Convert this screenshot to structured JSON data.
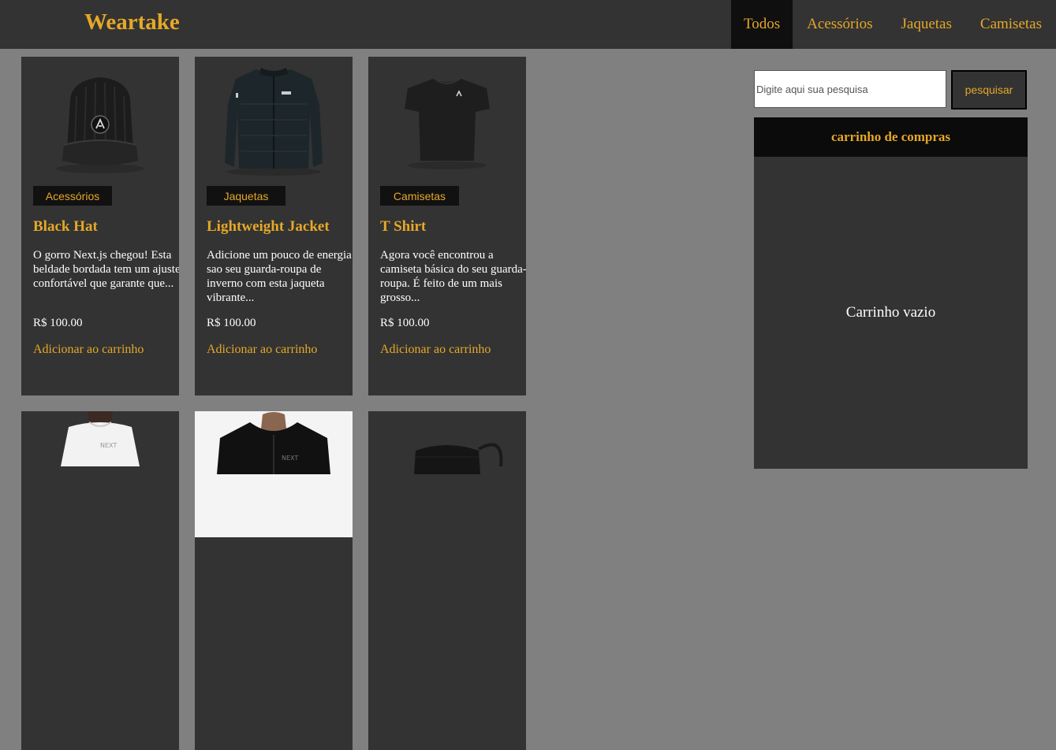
{
  "header": {
    "brand": "Weartake",
    "nav": [
      {
        "label": "Todos",
        "active": true
      },
      {
        "label": "Acessórios",
        "active": false
      },
      {
        "label": "Jaquetas",
        "active": false
      },
      {
        "label": "Camisetas",
        "active": false
      }
    ]
  },
  "products": [
    {
      "category": "Acessórios",
      "title": "Black Hat",
      "description": "O gorro Next.js chegou! Esta beldade bordada tem um ajuste confortável que garante que...",
      "price": "R$ 100.00",
      "add_label": "Adicionar ao carrinho",
      "icon": "beanie-image"
    },
    {
      "category": "Jaquetas",
      "title": "Lightweight Jacket",
      "description": "Adicione um pouco de energia sao seu guarda-roupa de inverno com esta jaqueta vibrante...",
      "price": "R$ 100.00",
      "add_label": "Adicionar ao carrinho",
      "icon": "jacket-image"
    },
    {
      "category": "Camisetas",
      "title": "T Shirt",
      "description": "Agora você encontrou a camiseta básica do seu guarda-roupa. É feito de um mais grosso...",
      "price": "R$ 100.00",
      "add_label": "Adicionar ao carrinho",
      "icon": "tshirt-image"
    }
  ],
  "products_row2": [
    {
      "icon": "white-tshirt-model-image"
    },
    {
      "icon": "hoodie-model-image"
    },
    {
      "icon": "face-mask-image"
    }
  ],
  "search": {
    "placeholder": "Digite aqui sua pesquisa",
    "button_label": "pesquisar"
  },
  "cart": {
    "title": "carrinho de compras",
    "empty_text": "Carrinho vazio"
  },
  "colors": {
    "accent": "#E5A828",
    "page_bg": "#808080",
    "panel_bg": "#333333",
    "dark": "#0b0b0b"
  }
}
